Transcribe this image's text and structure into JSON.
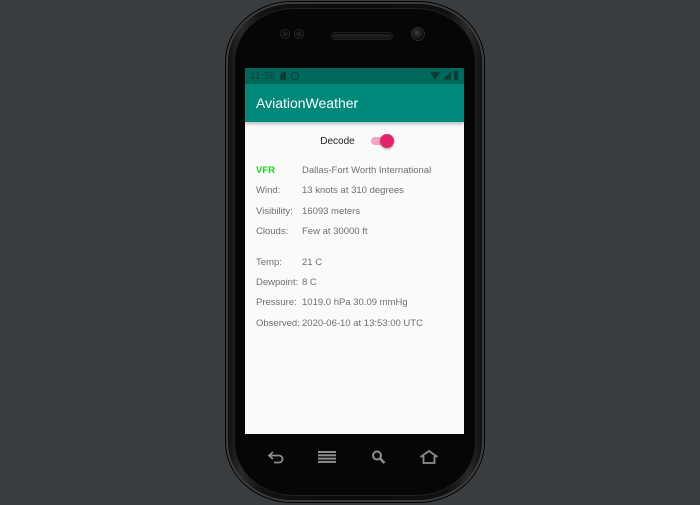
{
  "status_bar": {
    "time": "11:36",
    "icons": [
      "sim-icon",
      "sync-icon",
      "wifi-icon",
      "cell-signal-icon",
      "battery-icon"
    ]
  },
  "app_bar": {
    "title": "AviationWeather",
    "color": "#00897b"
  },
  "decode_switch": {
    "label": "Decode",
    "checked": true,
    "color": "#e0246c"
  },
  "weather": {
    "flight_category": {
      "label": "VFR",
      "value": "Dallas-Fort Worth International",
      "color": "#1ed31e"
    },
    "wind": {
      "label": "Wind:",
      "value": "13 knots at 310 degrees"
    },
    "visibility": {
      "label": "Visibility:",
      "value": "16093 meters"
    },
    "clouds": {
      "label": "Clouds:",
      "value": "Few at 30000 ft"
    },
    "temp": {
      "label": "Temp:",
      "value": "21 C"
    },
    "dewpoint": {
      "label": "Dewpoint:",
      "value": "8 C"
    },
    "pressure": {
      "label": "Pressure:",
      "value": "1019.0 hPa 30.09 mmHg"
    },
    "observed": {
      "label": "Observed:",
      "value": "2020-06-10 at 13:53:00 UTC"
    }
  },
  "nav_keys": [
    "back-icon",
    "menu-icon",
    "search-icon",
    "home-icon"
  ]
}
